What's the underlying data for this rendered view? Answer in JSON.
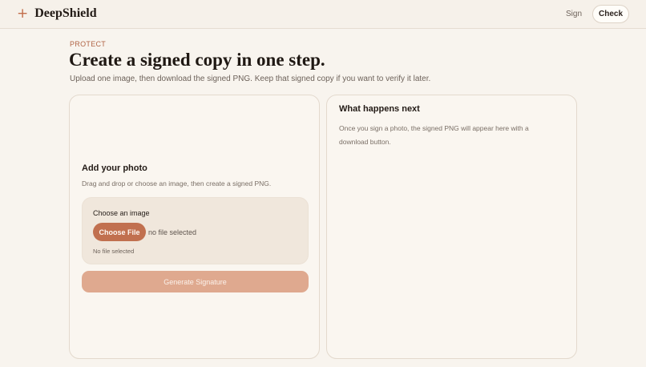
{
  "header": {
    "brand_icon": "plus-icon",
    "brand_name": "DeepShield",
    "nav": {
      "sign_label": "Sign",
      "check_label": "Check"
    }
  },
  "page": {
    "eyebrow": "PROTECT",
    "title": "Create a signed copy in one step.",
    "subtitle": "Upload one image, then download the signed PNG. Keep that signed copy if you want to verify it later."
  },
  "upload_card": {
    "title": "Add your photo",
    "description": "Drag and drop or choose an image, then create a signed PNG.",
    "field_label": "Choose an image",
    "choose_button": "Choose File",
    "file_status_inline": "no file selected",
    "file_status_note": "No file selected",
    "generate_button": "Generate Signature"
  },
  "next_card": {
    "title": "What happens next",
    "description": "Once you sign a photo, the signed PNG will appear here with a download button."
  },
  "colors": {
    "accent": "#c1704f",
    "accent_disabled": "#dfa98f",
    "background": "#f8f4ee"
  }
}
